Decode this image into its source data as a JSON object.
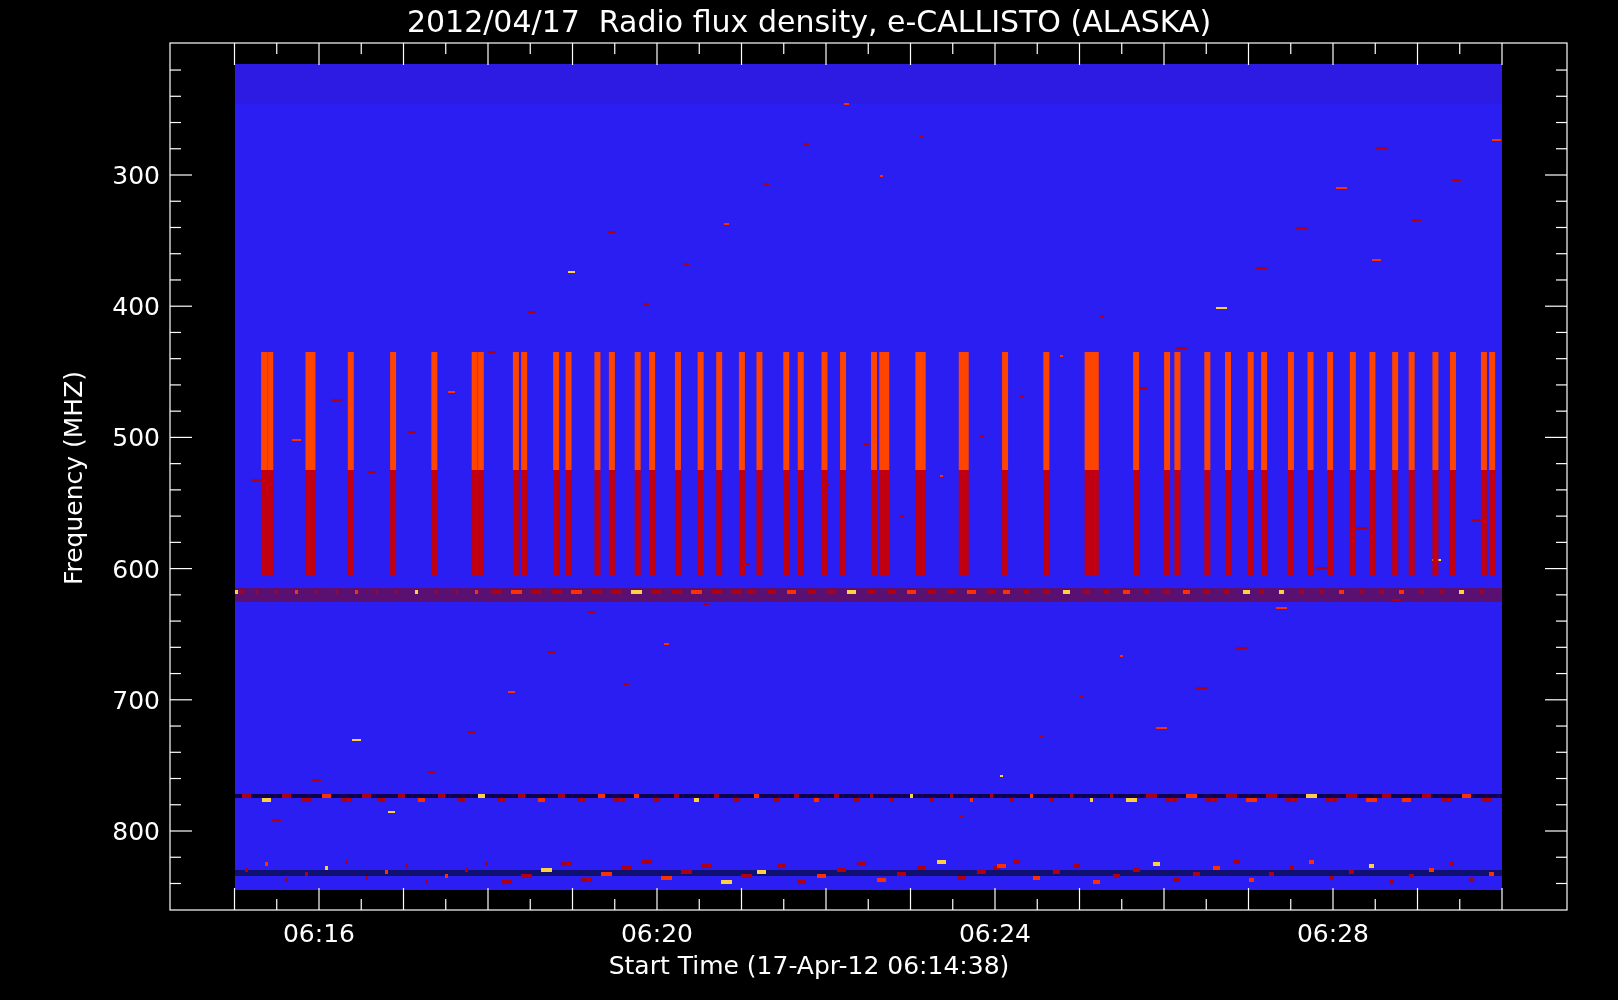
{
  "title": "2012/04/17  Radio flux density, e-CALLISTO (ALASKA)",
  "y_axis": {
    "label": "Frequency (MHZ)",
    "ticks": [
      "300",
      "400",
      "500",
      "600",
      "700",
      "800"
    ]
  },
  "x_axis": {
    "label": "Start Time (17-Apr-12 06:14:38)",
    "ticks": [
      "06:16",
      "06:20",
      "06:24",
      "06:28"
    ]
  }
}
